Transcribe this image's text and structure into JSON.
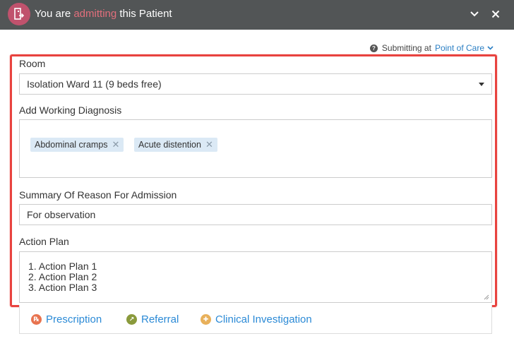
{
  "titlebar": {
    "prefix": "You are",
    "highlight": "admitting",
    "suffix": "this Patient",
    "icon": "discharge-door-icon",
    "accent_color": "#c0526d",
    "highlight_color": "#e26f7c"
  },
  "submit": {
    "label": "Submitting at",
    "location": "Point of Care"
  },
  "room": {
    "label": "Room",
    "selected": "Isolation Ward 11 (9 beds free)"
  },
  "diagnosis": {
    "label": "Add Working Diagnosis",
    "tags": [
      "Abdominal cramps",
      "Acute distention"
    ]
  },
  "reason": {
    "label": "Summary Of Reason For Admission",
    "value": "For observation"
  },
  "action_plan": {
    "label": "Action Plan",
    "lines": [
      "1. Action Plan 1",
      "2. Action Plan 2",
      "3. Action Plan 3"
    ]
  },
  "actions": [
    {
      "label": "Prescription",
      "icon": "prescription-icon",
      "color": "#e8734f"
    },
    {
      "label": "Referral",
      "icon": "referral-icon",
      "color": "#8a9a3c"
    },
    {
      "label": "Clinical Investigation",
      "icon": "investigation-icon",
      "color": "#e8b05a"
    }
  ],
  "colors": {
    "highlight_frame": "#e8433f",
    "link": "#2b8ad6",
    "titlebar_bg": "#525556"
  }
}
